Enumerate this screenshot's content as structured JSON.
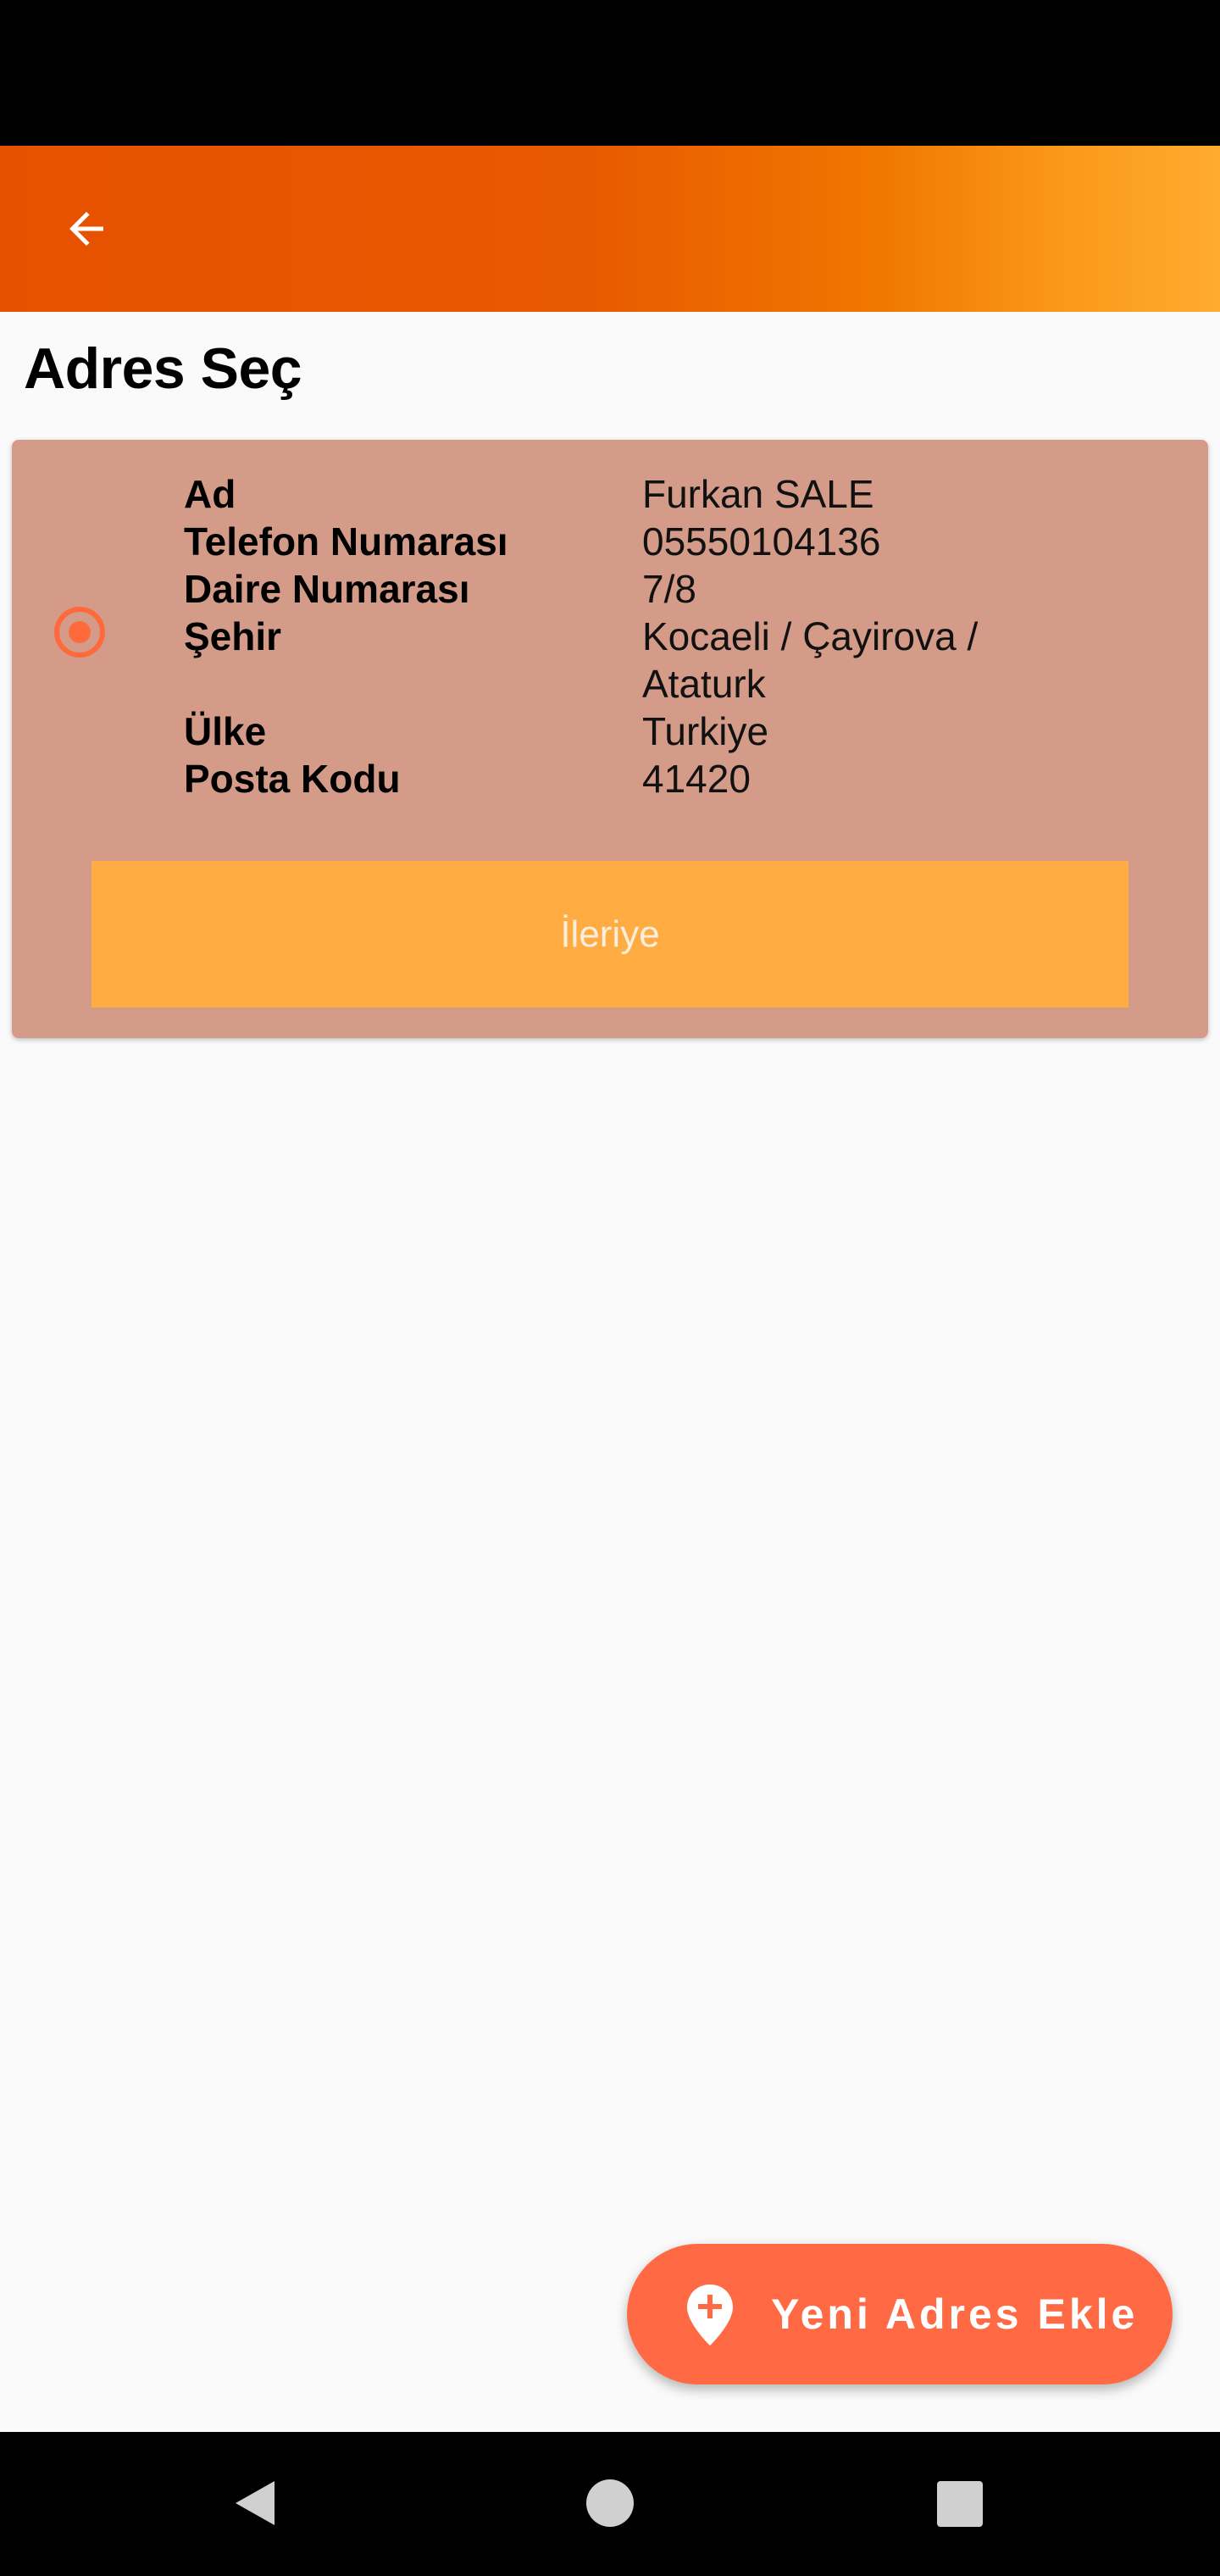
{
  "page": {
    "title": "Adres Seç",
    "back_icon": "arrow-left-icon"
  },
  "address": {
    "selected": true,
    "fields": [
      {
        "label": "Ad",
        "value": "Furkan SALE"
      },
      {
        "label": "Telefon Numarası",
        "value": "05550104136"
      },
      {
        "label": "Daire Numarası",
        "value": "7/8"
      },
      {
        "label": "Şehir",
        "value_lines": [
          "Kocaeli / Çayirova /",
          "Ataturk"
        ]
      },
      {
        "label": "Ülke",
        "value": "Turkiye"
      },
      {
        "label": "Posta Kodu",
        "value": "41420"
      }
    ],
    "next_button_label": "İleriye"
  },
  "fab": {
    "label": "Yeni Adres Ekle",
    "icon": "add-location-icon"
  },
  "nav": {
    "back_icon": "nav-back-icon",
    "home_icon": "nav-home-icon",
    "recents_icon": "nav-recents-icon"
  },
  "colors": {
    "app_bar_start": "#e65100",
    "app_bar_end": "#ffab2e",
    "card_background": "#d39b88",
    "accent": "#ff6a3d",
    "next_button": "#ffac42"
  }
}
